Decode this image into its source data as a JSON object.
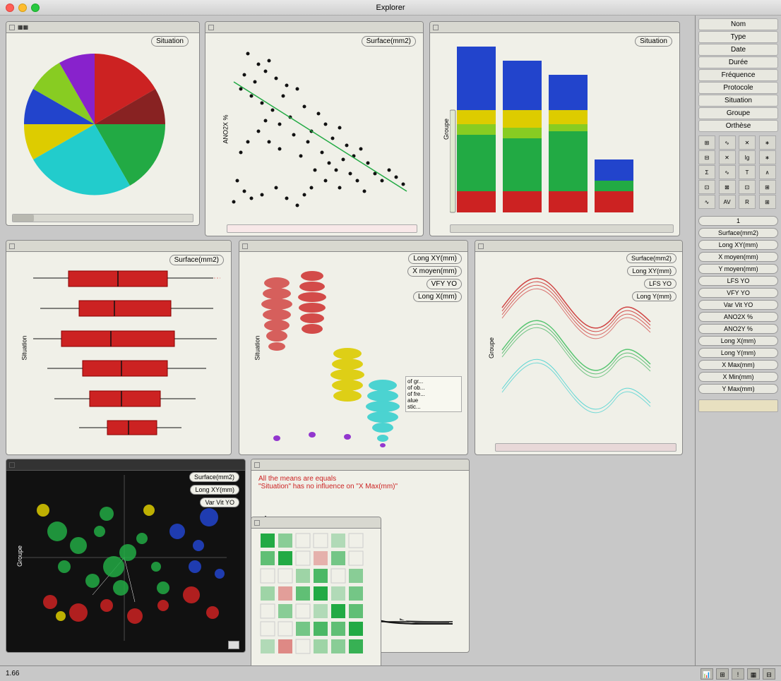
{
  "app": {
    "title": "Explorer",
    "version": "1.66"
  },
  "sidebar": {
    "menu_items": [
      "Nom",
      "Type",
      "Date",
      "Durée",
      "Fréquence",
      "Protocole",
      "Situation",
      "Groupe",
      "Orthèse"
    ],
    "variables": [
      "1",
      "Surface(mm2)",
      "Long XY(mm)",
      "X moyen(mm)",
      "Y moyen(mm)",
      "LFS YO",
      "VFY YO",
      "Var Vit YO",
      "ANO2X %",
      "ANO2Y %",
      "Long X(mm)",
      "Long Y(mm)",
      "X Max(mm)",
      "X Min(mm)",
      "Y Max(mm)"
    ]
  },
  "panels": {
    "pie": {
      "title": "Situation",
      "axis_label": ""
    },
    "scatter": {
      "title": "Surface(mm2)",
      "x_axis": "ANO2X %"
    },
    "bar_stacked": {
      "title": "Situation",
      "y_axis": "Groupe"
    },
    "boxplot": {
      "title": "Surface(mm2)",
      "y_axis": "Situation"
    },
    "violin": {
      "title": "",
      "y_axis": "Situation",
      "legend": [
        "Long XY(mm)",
        "X moyen(mm)",
        "VFY YO",
        "Long X(mm)"
      ]
    },
    "lines": {
      "title": "",
      "y_axis": "Groupe",
      "legend": [
        "Surface(mm2)",
        "Long XY(mm)",
        "LFS YO",
        "Long Y(mm)"
      ]
    },
    "bubble": {
      "title": "",
      "y_axis": "Groupe",
      "legend": [
        "Surface(mm2)",
        "Long XY(mm)",
        "Var Vit YO"
      ]
    },
    "anova": {
      "message_line1": "All the means are equals",
      "message_line2": "\"Situation\" has no influence on \"X Max(mm)\"",
      "x_axis": "F"
    },
    "matrix": {
      "title": ""
    }
  },
  "colors": {
    "red": "#cc2222",
    "blue": "#2244cc",
    "green": "#22aa44",
    "cyan": "#22cccc",
    "yellow": "#ddcc00",
    "orange": "#dd8800",
    "purple": "#8822cc",
    "darkgreen": "#115522",
    "lime": "#88cc22",
    "accent": "#cc2222"
  },
  "statusbar": {
    "version": "1.66"
  }
}
